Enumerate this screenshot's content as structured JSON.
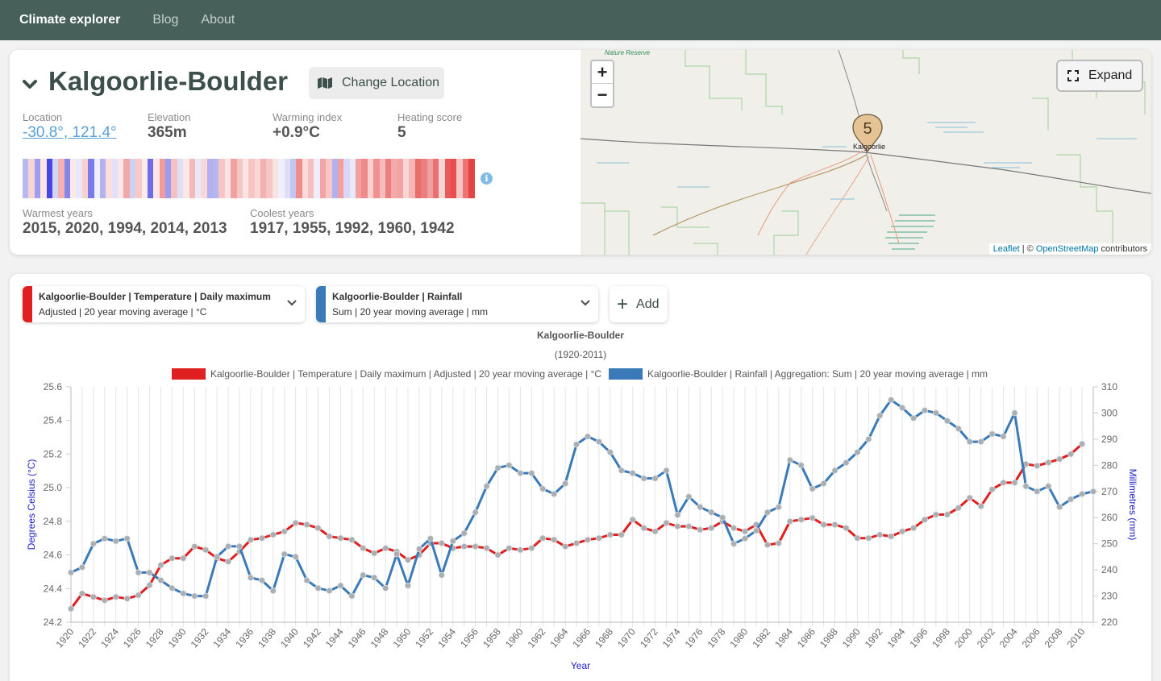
{
  "nav": {
    "brand": "Climate explorer",
    "links": [
      "Blog",
      "About"
    ]
  },
  "location": {
    "name": "Kalgoorlie-Boulder",
    "change_label": "Change Location",
    "stats": [
      {
        "label": "Location",
        "value": "-30.8°, 121.4°"
      },
      {
        "label": "Elevation",
        "value": "365m"
      },
      {
        "label": "Warming index",
        "value": "+0.9°C"
      },
      {
        "label": "Heating score",
        "value": "5"
      }
    ],
    "warmest_label": "Warmest years",
    "warmest_value": "2015, 2020, 1994, 2014, 2013",
    "coolest_label": "Coolest years",
    "coolest_value": "1917, 1955, 1992, 1960, 1942",
    "info_icon": "i",
    "stripe_colors": [
      "#b8b8f2",
      "#f7d3d3",
      "#9e9eef",
      "#fbe5e5",
      "#4747e3",
      "#d4d4f5",
      "#f5b0b0",
      "#8585ec",
      "#fde8e8",
      "#e8e8fa",
      "#f9d0d0",
      "#7a7ae9",
      "#efefff",
      "#b3b3f0",
      "#fcdede",
      "#e0e0f8",
      "#fbe7e7",
      "#f0a8a8",
      "#d0d0f5",
      "#f7c9c9",
      "#fcebeb",
      "#6d6de6",
      "#ffe5e5",
      "#f59a9a",
      "#9c9cee",
      "#f6c0c0",
      "#dedef7",
      "#fce7e7",
      "#f5b8b8",
      "#e8e8fa",
      "#f8d7d7",
      "#b1b1f0",
      "#b5b5f2",
      "#f7c5c5",
      "#fde4e4",
      "#f2a0a0",
      "#f5c6c6",
      "#fbe3e3",
      "#f7c4c4",
      "#fad7d7",
      "#f3b0b0",
      "#f6c6c6",
      "#fbe2e2",
      "#efefff",
      "#dedef7",
      "#c3c3f4",
      "#f08c8c",
      "#fadada",
      "#f6bebe",
      "#ededfb",
      "#f3a5a5",
      "#f7c6c6",
      "#b1b1ef",
      "#f59e9e",
      "#d8d8f6",
      "#e9e9fa",
      "#f2a0a0",
      "#ee8a8a",
      "#f9d0d0",
      "#f09090",
      "#f7bdbd",
      "#ec7f7f",
      "#f4aaaa",
      "#f3a3a3",
      "#f9d6d6",
      "#f6b5b5",
      "#e86e6e",
      "#eb7e7e",
      "#f0a0a0",
      "#ea7070",
      "#f8d5d5",
      "#e85959",
      "#e94e4e",
      "#f3c4c4",
      "#ed7272",
      "#e54444"
    ],
    "map": {
      "zoom_in": "+",
      "zoom_out": "−",
      "expand_label": "Expand",
      "marker_count": "5",
      "town_label": "Kalgoorlie",
      "reserve_label": "Nature Reserve",
      "attrib_leaflet": "Leaflet",
      "attrib_sep": " | © ",
      "attrib_osm": "OpenStreetMap",
      "attrib_tail": " contributors"
    }
  },
  "selectors": [
    {
      "line1": "Kalgoorlie-Boulder | Temperature | Daily maximum",
      "line2": "Adjusted | 20 year moving average | °C",
      "color": "#e02020"
    },
    {
      "line1": "Kalgoorlie-Boulder | Rainfall",
      "line2": "Sum | 20 year moving average | mm",
      "color": "#3a7ab8"
    }
  ],
  "add_label": "Add",
  "chart_data": {
    "type": "line",
    "title": "Kalgoorlie-Boulder",
    "subtitle": "(1920-2011)",
    "xlabel": "Year",
    "ylabel_left": "Degrees Celsius (°C)",
    "ylabel_right": "Millimetres (mm)",
    "y_left_range": [
      24.2,
      25.6
    ],
    "y_left_ticks": [
      "24.2",
      "24.4",
      "24.6",
      "24.8",
      "25.0",
      "25.2",
      "25.4",
      "25.6"
    ],
    "y_right_range": [
      220,
      310
    ],
    "y_right_ticks": [
      "220",
      "230",
      "240",
      "250",
      "260",
      "270",
      "280",
      "290",
      "300",
      "310"
    ],
    "x_ticks": [
      "1920",
      "1922",
      "1924",
      "1926",
      "1928",
      "1930",
      "1932",
      "1934",
      "1936",
      "1938",
      "1940",
      "1942",
      "1944",
      "1946",
      "1948",
      "1950",
      "1952",
      "1954",
      "1956",
      "1958",
      "1960",
      "1962",
      "1964",
      "1966",
      "1968",
      "1970",
      "1972",
      "1974",
      "1976",
      "1978",
      "1980",
      "1982",
      "1984",
      "1986",
      "1988",
      "1990",
      "1992",
      "1994",
      "1996",
      "1998",
      "2000",
      "2002",
      "2004",
      "2006",
      "2008",
      "2010"
    ],
    "grid": true,
    "legend_position": "top",
    "series": [
      {
        "name": "Kalgoorlie-Boulder | Temperature | Daily maximum | Adjusted | 20 year moving average | °C",
        "axis": "left",
        "color": "#e02020",
        "start_year": 1920,
        "values": [
          24.28,
          24.37,
          24.35,
          24.33,
          24.35,
          24.34,
          24.36,
          24.42,
          24.54,
          24.58,
          24.58,
          24.65,
          24.63,
          24.58,
          24.56,
          24.62,
          24.69,
          24.7,
          24.72,
          24.74,
          24.79,
          24.78,
          24.76,
          24.71,
          24.7,
          24.69,
          24.64,
          24.61,
          24.64,
          24.62,
          24.57,
          24.6,
          24.67,
          24.67,
          24.64,
          24.65,
          24.65,
          24.64,
          24.6,
          24.64,
          24.63,
          24.64,
          24.7,
          24.69,
          24.65,
          24.67,
          24.69,
          24.7,
          24.72,
          24.72,
          24.81,
          24.76,
          24.74,
          24.79,
          24.77,
          24.77,
          24.75,
          24.76,
          24.8,
          24.76,
          24.74,
          24.78,
          24.66,
          24.67,
          24.8,
          24.81,
          24.82,
          24.78,
          24.78,
          24.76,
          24.7,
          24.7,
          24.72,
          24.71,
          24.74,
          24.76,
          24.81,
          24.84,
          24.84,
          24.88,
          24.94,
          24.89,
          24.99,
          25.03,
          25.03,
          25.14,
          25.13,
          25.15,
          25.17,
          25.2,
          25.26
        ]
      },
      {
        "name": "Kalgoorlie-Boulder | Rainfall | Aggregation: Sum | 20 year moving average | mm",
        "axis": "right",
        "color": "#3a7ab8",
        "start_year": 1920,
        "values": [
          239,
          241,
          250,
          252,
          251,
          252,
          239,
          239,
          236,
          233,
          231,
          230,
          230,
          245,
          249,
          249,
          237,
          236,
          232,
          246,
          245,
          236,
          233,
          232,
          234,
          230,
          238,
          237,
          233,
          246,
          234,
          248,
          252,
          238,
          251,
          254,
          262,
          272,
          279,
          280,
          277,
          277,
          271,
          269,
          273,
          288,
          291,
          289,
          285,
          278,
          277,
          275,
          275,
          278,
          261,
          268,
          264,
          262,
          260,
          250,
          252,
          255,
          262,
          264,
          282,
          280,
          271,
          273,
          278,
          281,
          285,
          290,
          299,
          305,
          302,
          298,
          301,
          300,
          297,
          294,
          289,
          289,
          292,
          291,
          300,
          272,
          270,
          272,
          264,
          267,
          269,
          270
        ]
      }
    ]
  }
}
